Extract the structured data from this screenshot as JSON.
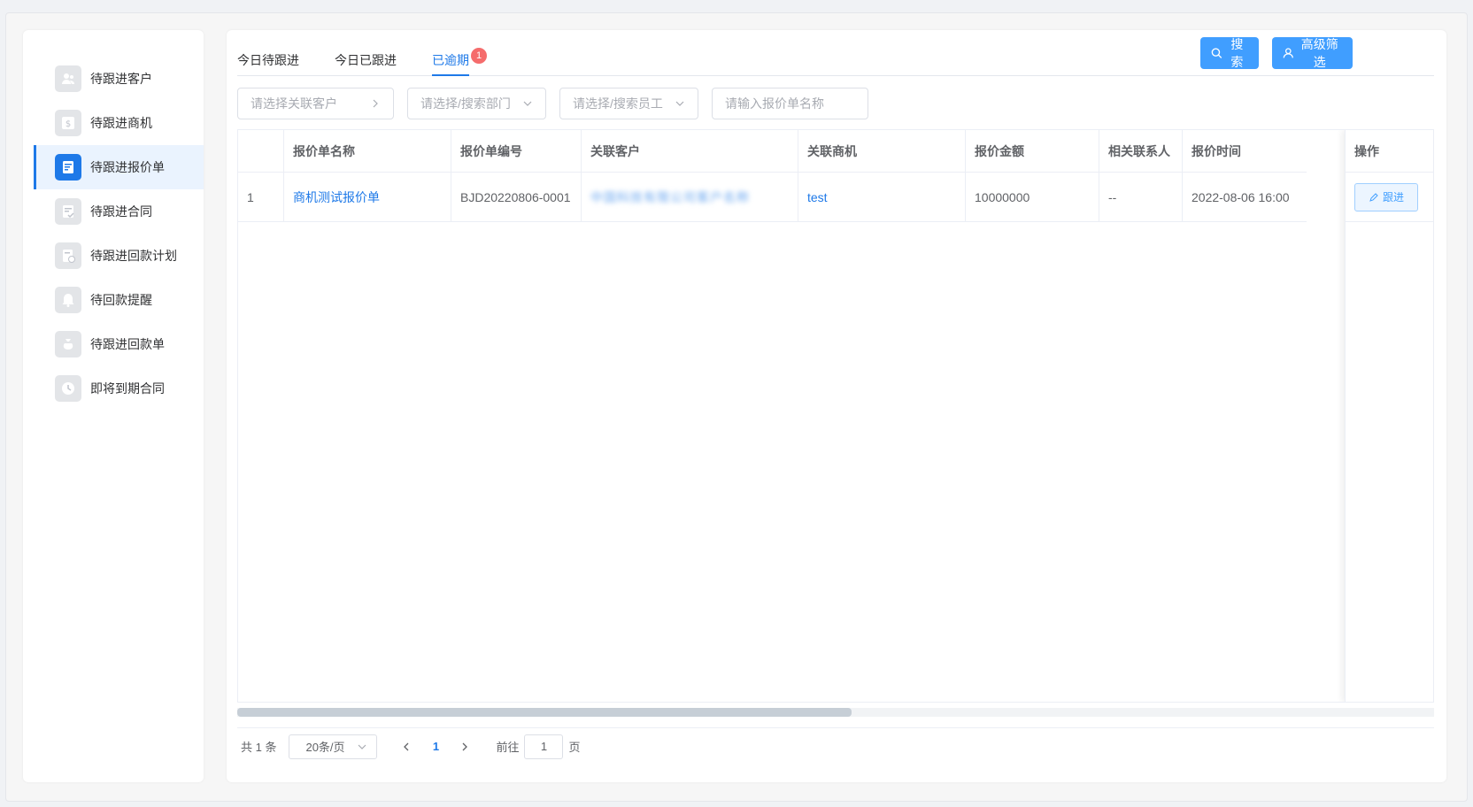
{
  "sidebar": {
    "items": [
      {
        "label": "待跟进客户",
        "icon": "customers-icon"
      },
      {
        "label": "待跟进商机",
        "icon": "opportunity-icon"
      },
      {
        "label": "待跟进报价单",
        "icon": "quote-icon",
        "active": true
      },
      {
        "label": "待跟进合同",
        "icon": "contract-icon"
      },
      {
        "label": "待跟进回款计划",
        "icon": "payment-plan-icon"
      },
      {
        "label": "待回款提醒",
        "icon": "bell-icon"
      },
      {
        "label": "待跟进回款单",
        "icon": "money-bag-icon"
      },
      {
        "label": "即将到期合同",
        "icon": "clock-icon"
      }
    ]
  },
  "tabs": [
    {
      "label": "今日待跟进"
    },
    {
      "label": "今日已跟进"
    },
    {
      "label": "已逾期",
      "badge": "1",
      "active": true
    }
  ],
  "toolbar": {
    "search_label": "搜索",
    "advanced_label": "高级筛选"
  },
  "filters": {
    "customer_placeholder": "请选择关联客户",
    "department_placeholder": "请选择/搜索部门",
    "employee_placeholder": "请选择/搜索员工",
    "quote_name_placeholder": "请输入报价单名称"
  },
  "table": {
    "headers": {
      "name": "报价单名称",
      "code": "报价单编号",
      "customer": "关联客户",
      "opportunity": "关联商机",
      "amount": "报价金额",
      "contact": "相关联系人",
      "time": "报价时间",
      "action": "操作"
    },
    "rows": [
      {
        "index": "1",
        "name": "商机测试报价单",
        "code": "BJD20220806-0001",
        "customer": "中国科技有限公司客户名称",
        "opportunity": "test",
        "amount": "10000000",
        "contact": "--",
        "time": "2022-08-06 16:00",
        "action_label": "跟进"
      }
    ]
  },
  "pagination": {
    "total": "共 1 条",
    "page_size": "20条/页",
    "current_page": "1",
    "goto_label": "前往",
    "goto_value": "1",
    "page_suffix": "页"
  },
  "colors": {
    "accent": "#1e79e8",
    "primary_button": "#409eff",
    "badge": "#f56c6c"
  }
}
